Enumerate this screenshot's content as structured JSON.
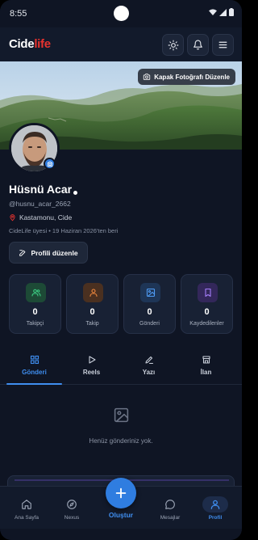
{
  "status_bar": {
    "time": "8:55"
  },
  "header": {
    "logo_part1": "Cide",
    "logo_part2": "life"
  },
  "cover": {
    "edit_label": "Kapak Fotoğrafı Düzenle"
  },
  "profile": {
    "name": "Hüsnü Acar",
    "username": "@husnu_acar_2662",
    "location": "Kastamonu, Cide",
    "member_since": "CideLife üyesi • 19 Haziran 2026'ten beri",
    "edit_label": "Profili düzenle"
  },
  "stats": [
    {
      "value": "0",
      "label": "Takipçi",
      "icon": "users-icon",
      "color": "#2ea66a"
    },
    {
      "value": "0",
      "label": "Takip",
      "icon": "user-icon",
      "color": "#e07a2f"
    },
    {
      "value": "0",
      "label": "Gönderi",
      "icon": "image-icon",
      "color": "#3f8ef0"
    },
    {
      "value": "0",
      "label": "Kaydedilenler",
      "icon": "bookmark-icon",
      "color": "#8b5cf6"
    }
  ],
  "tabs": [
    {
      "label": "Gönderi",
      "icon": "grid-icon",
      "active": true
    },
    {
      "label": "Reels",
      "icon": "play-icon",
      "active": false
    },
    {
      "label": "Yazı",
      "icon": "pen-icon",
      "active": false
    },
    {
      "label": "İlan",
      "icon": "store-icon",
      "active": false
    }
  ],
  "empty_state": {
    "text": "Henüz gönderiniz yok."
  },
  "bottom_nav": {
    "items": [
      {
        "label": "Ana Sayfa",
        "icon": "home-icon"
      },
      {
        "label": "Nexus",
        "icon": "compass-icon"
      },
      {
        "label": "Mesajlar",
        "icon": "chat-icon"
      },
      {
        "label": "Profil",
        "icon": "profile-icon",
        "active": true
      }
    ],
    "create_label": "Oluştur"
  },
  "colors": {
    "accent": "#3f8ef0",
    "brand_red": "#e8332f",
    "background": "#0f1524"
  }
}
